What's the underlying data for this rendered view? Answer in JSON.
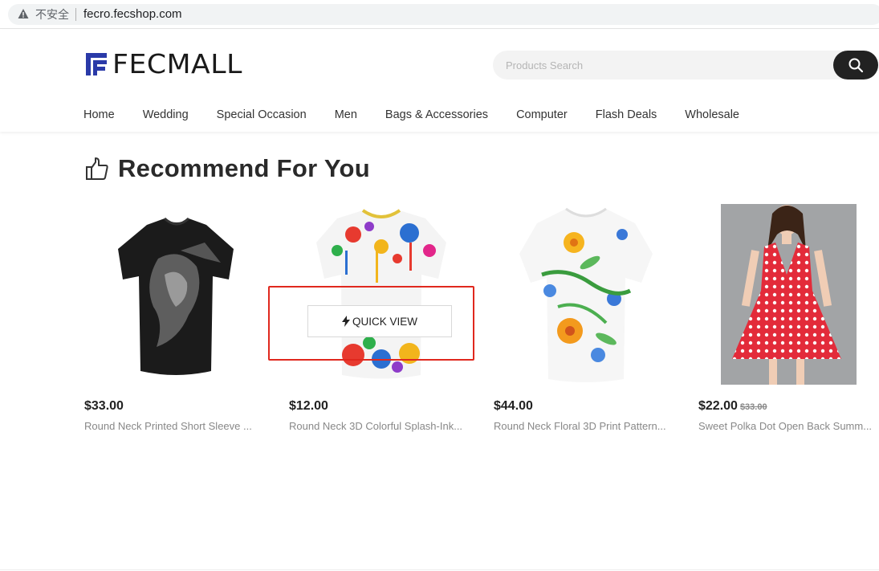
{
  "browser": {
    "security_label": "不安全",
    "url": "fecro.fecshop.com"
  },
  "header": {
    "logo_text": "FECMALL",
    "search_placeholder": "Products Search",
    "nav": [
      "Home",
      "Wedding",
      "Special Occasion",
      "Men",
      "Bags & Accessories",
      "Computer",
      "Flash Deals",
      "Wholesale"
    ]
  },
  "section": {
    "title": "Recommend For You"
  },
  "products": [
    {
      "price": "$33.00",
      "old_price": "",
      "name": "Round Neck Printed Short Sleeve ..."
    },
    {
      "price": "$12.00",
      "old_price": "",
      "name": "Round Neck 3D Colorful Splash-Ink..."
    },
    {
      "price": "$44.00",
      "old_price": "",
      "name": "Round Neck Floral 3D Print Pattern..."
    },
    {
      "price": "$22.00",
      "old_price": "$33.00",
      "name": "Sweet Polka Dot Open Back Summ..."
    }
  ],
  "quick_view_label": "QUICK VIEW",
  "colors": {
    "brand_blue": "#2a3aa8",
    "highlight_red": "#e0281e",
    "search_button": "#222222"
  }
}
